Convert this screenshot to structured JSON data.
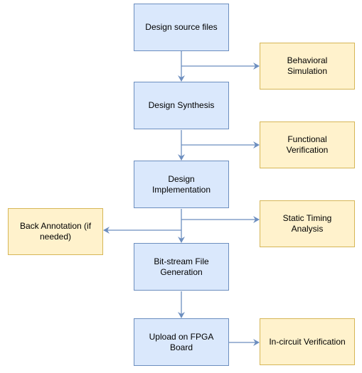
{
  "colors": {
    "process_fill": "#dae8fc",
    "process_stroke": "#6c8ebf",
    "check_fill": "#fff2cc",
    "check_stroke": "#d6b656",
    "arrow": "#6c8ebf"
  },
  "steps": [
    {
      "label": "Design source files"
    },
    {
      "label": "Design Synthesis"
    },
    {
      "label": "Design Implementation"
    },
    {
      "label": "Bit-stream File Generation"
    },
    {
      "label": "Upload on FPGA Board"
    }
  ],
  "checks": [
    {
      "label": "Behavioral Simulation"
    },
    {
      "label": "Functional Verification"
    },
    {
      "label": "Static Timing Analysis"
    },
    {
      "label": "In-circuit Verification"
    }
  ],
  "feedback": {
    "label": "Back Annotation (if needed)"
  }
}
